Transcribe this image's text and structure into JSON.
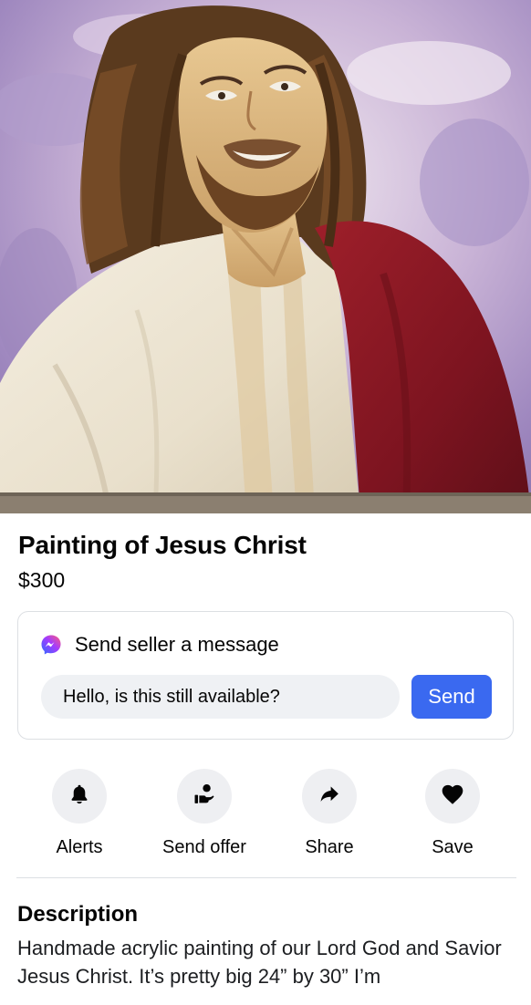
{
  "listing": {
    "title": "Painting of Jesus Christ",
    "price": "$300"
  },
  "message_card": {
    "heading": "Send seller a message",
    "input_value": "Hello, is this still available?",
    "send_label": "Send",
    "messenger_icon": "messenger-icon",
    "accent_color": "#3a69f0"
  },
  "actions": [
    {
      "label": "Alerts",
      "icon": "bell-icon"
    },
    {
      "label": "Send offer",
      "icon": "offer-icon"
    },
    {
      "label": "Share",
      "icon": "share-arrow-icon"
    },
    {
      "label": "Save",
      "icon": "heart-icon"
    }
  ],
  "description": {
    "heading": "Description",
    "body": "Handmade acrylic painting of our Lord God and Savior Jesus Christ. It’s pretty big 24” by 30” I’m"
  }
}
